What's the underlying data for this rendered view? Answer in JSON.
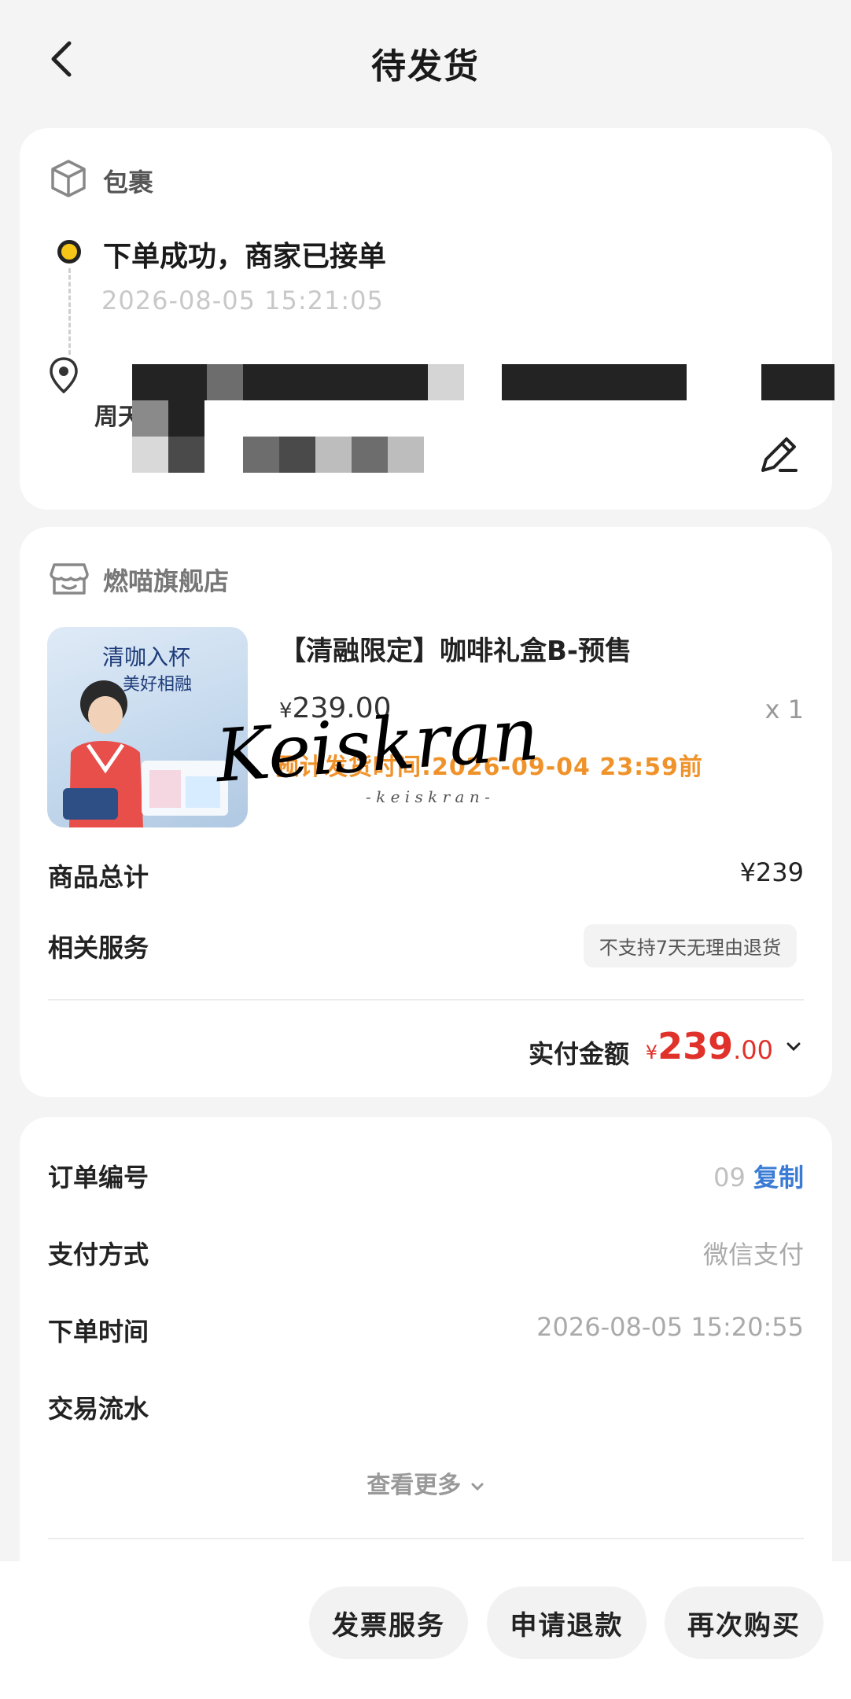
{
  "header": {
    "title": "待发货"
  },
  "package": {
    "label": "包裹",
    "status": "下单成功，商家已接单",
    "status_time": "2026-08-05 15:21:05",
    "address_name": "周天骄"
  },
  "shop": {
    "name": "燃喵旗舰店",
    "product": {
      "image_text_1": "清咖入杯",
      "image_text_2": "美好相融",
      "name": "【清融限定】咖啡礼盒B-预售",
      "currency": "¥",
      "price": "239.00",
      "qty": "x 1",
      "ship_eta": "预计发货时间:2026-09-04 23:59前"
    },
    "watermark": {
      "main": "Keiskran",
      "sub": "- k e i s k r a n -"
    },
    "subtotal_label": "商品总计",
    "subtotal_value": "¥239",
    "service_label": "相关服务",
    "service_badge": "不支持7天无理由退货",
    "paid_label": "实付金额",
    "paid_currency": "¥",
    "paid_int": "239",
    "paid_dec": ".00"
  },
  "order_info": {
    "order_no_label": "订单编号",
    "order_no_value": "09",
    "copy_label": "复制",
    "pay_method_label": "支付方式",
    "pay_method_value": "微信支付",
    "order_time_label": "下单时间",
    "order_time_value": "2026-08-05 15:20:55",
    "trade_flow_label": "交易流水",
    "view_more": "查看更多"
  },
  "bottom": {
    "invoice": "发票服务",
    "refund": "申请退款",
    "rebuy": "再次购买"
  },
  "colors": {
    "accent_price": "#e0312a",
    "eta_orange": "#f0922a",
    "link_blue": "#3a7bd5",
    "status_dot": "#f5c518"
  }
}
